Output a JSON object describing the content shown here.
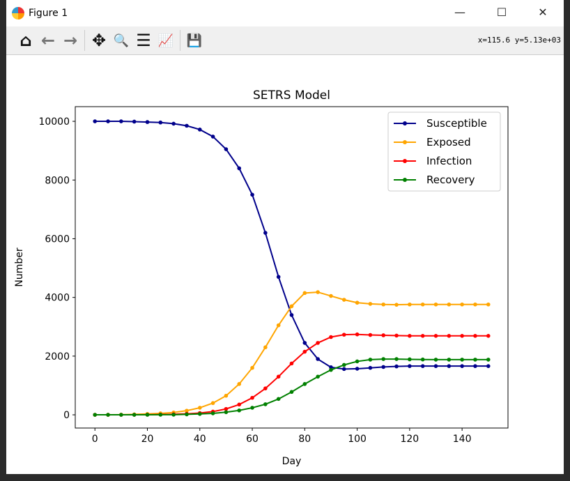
{
  "window": {
    "title": "Figure 1",
    "minimize": "—",
    "maximize": "☐",
    "close": "✕"
  },
  "toolbar": {
    "home": "⌂",
    "back": "←",
    "forward": "→",
    "pan": "✥",
    "zoom": "🔍",
    "configure": "☰",
    "edit": "📈",
    "save": "💾",
    "coords": "x=115.6  y=5.13e+03"
  },
  "chart_data": {
    "type": "line",
    "title": "SETRS Model",
    "xlabel": "Day",
    "ylabel": "Number",
    "xlim": [
      -7.5,
      157.5
    ],
    "ylim": [
      -450,
      10500
    ],
    "xticks": [
      0,
      20,
      40,
      60,
      80,
      100,
      120,
      140
    ],
    "yticks": [
      0,
      2000,
      4000,
      6000,
      8000,
      10000
    ],
    "legend_position": "top-right",
    "x": [
      0,
      5,
      10,
      15,
      20,
      25,
      30,
      35,
      40,
      45,
      50,
      55,
      60,
      65,
      70,
      75,
      80,
      85,
      90,
      95,
      100,
      105,
      110,
      115,
      120,
      125,
      130,
      135,
      140,
      145,
      150
    ],
    "series": [
      {
        "name": "Susceptible",
        "color": "#00008b",
        "values": [
          10000,
          10000,
          10000,
          9990,
          9975,
          9960,
          9920,
          9850,
          9720,
          9480,
          9050,
          8400,
          7500,
          6200,
          4700,
          3400,
          2450,
          1900,
          1620,
          1560,
          1570,
          1600,
          1630,
          1650,
          1660,
          1660,
          1660,
          1660,
          1660,
          1660,
          1660
        ]
      },
      {
        "name": "Exposed",
        "color": "#ffa500",
        "values": [
          0,
          2,
          5,
          15,
          30,
          50,
          80,
          140,
          240,
          400,
          650,
          1050,
          1600,
          2300,
          3050,
          3700,
          4150,
          4180,
          4050,
          3920,
          3820,
          3780,
          3760,
          3750,
          3760,
          3760,
          3760,
          3760,
          3760,
          3760,
          3760
        ]
      },
      {
        "name": "Infection",
        "color": "#ff0000",
        "values": [
          0,
          0,
          1,
          2,
          5,
          10,
          20,
          35,
          60,
          110,
          200,
          350,
          580,
          900,
          1300,
          1750,
          2150,
          2450,
          2650,
          2730,
          2740,
          2720,
          2710,
          2700,
          2690,
          2690,
          2690,
          2690,
          2690,
          2690,
          2690
        ]
      },
      {
        "name": "Recovery",
        "color": "#008000",
        "values": [
          0,
          0,
          0,
          1,
          2,
          3,
          5,
          15,
          30,
          50,
          90,
          150,
          240,
          360,
          540,
          780,
          1050,
          1300,
          1530,
          1700,
          1820,
          1880,
          1900,
          1900,
          1890,
          1885,
          1880,
          1880,
          1880,
          1880,
          1880
        ]
      }
    ]
  }
}
